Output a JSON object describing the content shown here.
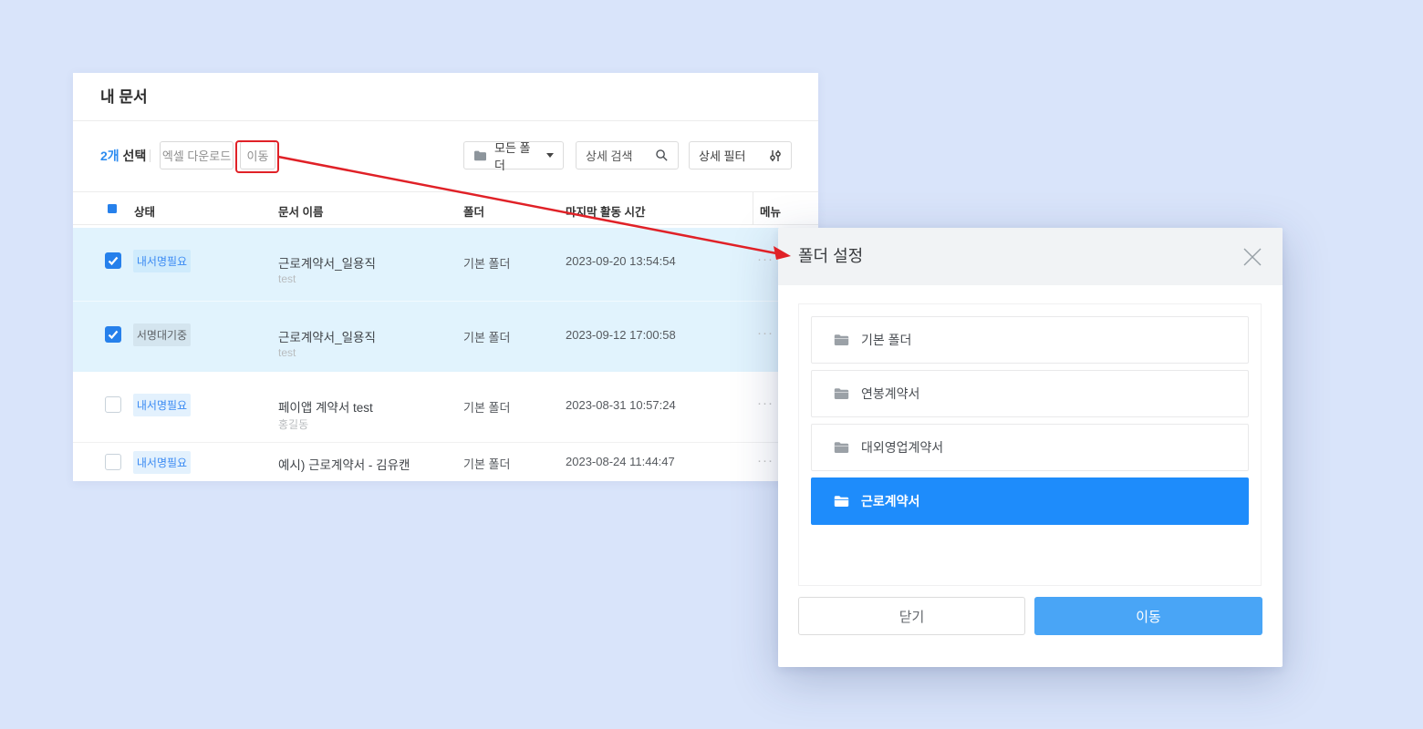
{
  "panel": {
    "title": "내 문서",
    "toolbar": {
      "selection_count": "2개",
      "selection_label": " 선택",
      "excel_button": "엑셀 다운로드",
      "move_button": "이동",
      "folder_filter": "모든 폴더",
      "search_label": "상세 검색",
      "filter_button": "상세 필터"
    },
    "table": {
      "headers": {
        "status": "상태",
        "name": "문서 이름",
        "folder": "폴더",
        "time": "마지막 활동 시간",
        "menu": "메뉴"
      },
      "menu_icon": "···",
      "rows": [
        {
          "checked": true,
          "status": "내서명필요",
          "status_type": "blue",
          "name": "근로계약서_일용직",
          "sub": "test",
          "folder": "기본 폴더",
          "time": "2023-09-20 13:54:54"
        },
        {
          "checked": true,
          "status": "서명대기중",
          "status_type": "gray",
          "name": "근로계약서_일용직",
          "sub": "test",
          "folder": "기본 폴더",
          "time": "2023-09-12 17:00:58"
        },
        {
          "checked": false,
          "status": "내서명필요",
          "status_type": "blue",
          "name": "페이앱 계약서 test",
          "sub": "홍길동",
          "folder": "기본 폴더",
          "time": "2023-08-31 10:57:24"
        },
        {
          "checked": false,
          "status": "내서명필요",
          "status_type": "blue",
          "name": "예시) 근로계약서 - 김유캔",
          "sub": "",
          "folder": "기본 폴더",
          "time": "2023-08-24 11:44:47"
        }
      ]
    }
  },
  "modal": {
    "title": "폴더 설정",
    "folders": [
      {
        "label": "기본 폴더",
        "selected": false
      },
      {
        "label": "연봉계약서",
        "selected": false
      },
      {
        "label": "대외영업계약서",
        "selected": false
      },
      {
        "label": "근로계약서",
        "selected": true
      }
    ],
    "close_button": "닫기",
    "move_button": "이동"
  },
  "colors": {
    "page_background": "#d9e4fa",
    "accent_blue": "#2d8cf0",
    "selected_row_background": "#e1f3fd",
    "selected_folder_background": "#1e8cfb",
    "primary_button_background": "#49a5f6",
    "annotation_red": "#e02127",
    "status_blue_text": "#3a8af3",
    "status_gray_text": "#5d6166"
  }
}
